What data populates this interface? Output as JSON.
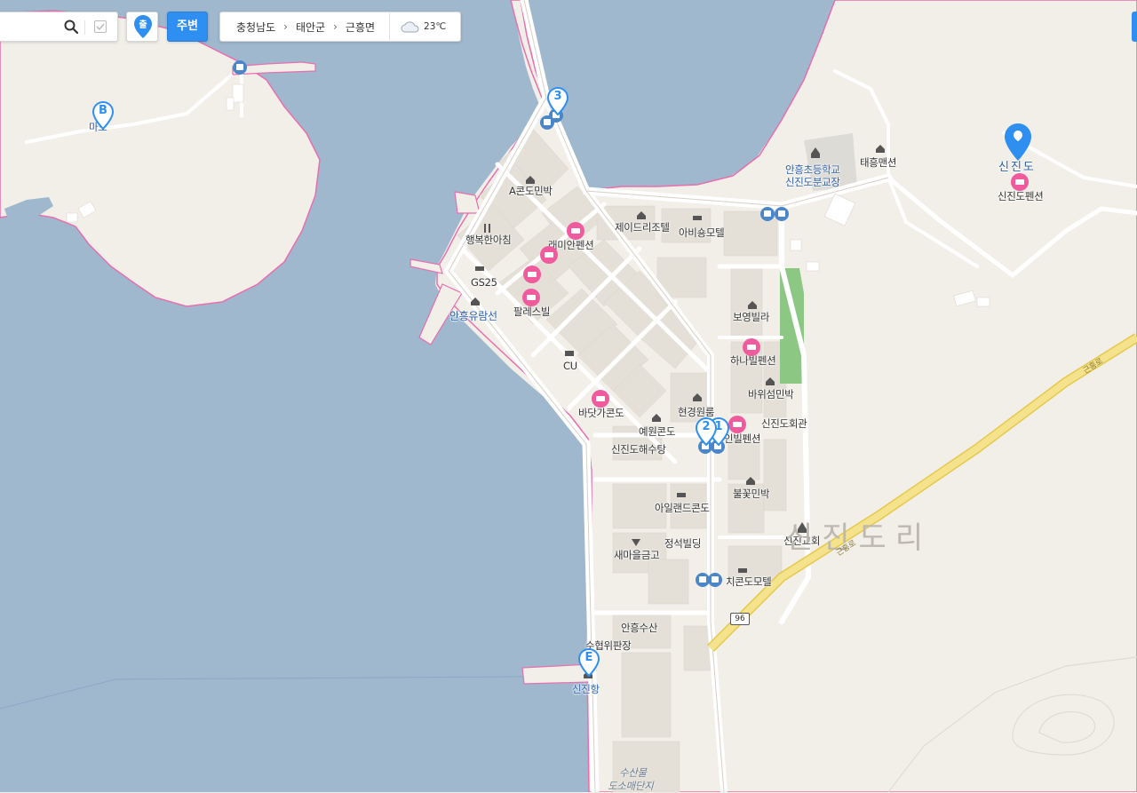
{
  "toolbar": {
    "search_value": "",
    "pin_label": "출",
    "nearby_label": "주변",
    "breadcrumb": [
      "충청남도",
      "태안군",
      "근흥면"
    ],
    "weather": {
      "temp": "23℃",
      "icon": "cloud-icon"
    }
  },
  "map": {
    "region_label": "신진도리",
    "road_name": "근흥로",
    "road_number": "96",
    "markers": {
      "b": "B",
      "e": "E",
      "m1": "1",
      "m2": "2",
      "m3": "3"
    },
    "labels": {
      "mado": "마도",
      "sinjindo": "신진도",
      "sinjindo_pension": "신진도펜션",
      "school_line1": "안흥초등학교",
      "school_line2": "신진도분교장",
      "taeheung": "태흥맨션",
      "a_condo": "A콘도민박",
      "happy_sashimi": "행복한아침",
      "gs25": "GS25",
      "ferry": "안흥유람선",
      "jd_resort": "제이드리조텔",
      "abi_motel": "아비숑모텔",
      "raemian": "래미안펜션",
      "palace": "팔레스빌",
      "cu": "CU",
      "boyoung": "보영빌라",
      "hana": "하나빌펜션",
      "bawisum": "바위섬민박",
      "seaside_condo": "바닷가콘도",
      "hyungyoung": "현경원룸",
      "yewon": "예원콘도",
      "hall": "신진도회관",
      "inn_pension": "인빌펜션",
      "sauna": "신진도해수탕",
      "bulkkot": "불꽃민박",
      "island_condo": "아일랜드콘도",
      "church": "신진교회",
      "jungseok": "정석빌딩",
      "saemaeul": "새마을금고",
      "value_motel": "치콘도모텔",
      "anheung_fish": "안흥수산",
      "suhyup": "수협위판장",
      "sinjin_port": "신진항",
      "fish_market_1": "수산물",
      "fish_market_2": "도소매단지"
    }
  },
  "colors": {
    "water": "#9fb8ce",
    "land": "#f2efe9",
    "shore": "#e86fae",
    "block": "#e4e0d8",
    "road": "#ffffff",
    "highway": "#f4e38c",
    "park": "#8cc784",
    "marker_blue": "#2f8ff0",
    "marker_pink": "#ef5b9c"
  }
}
